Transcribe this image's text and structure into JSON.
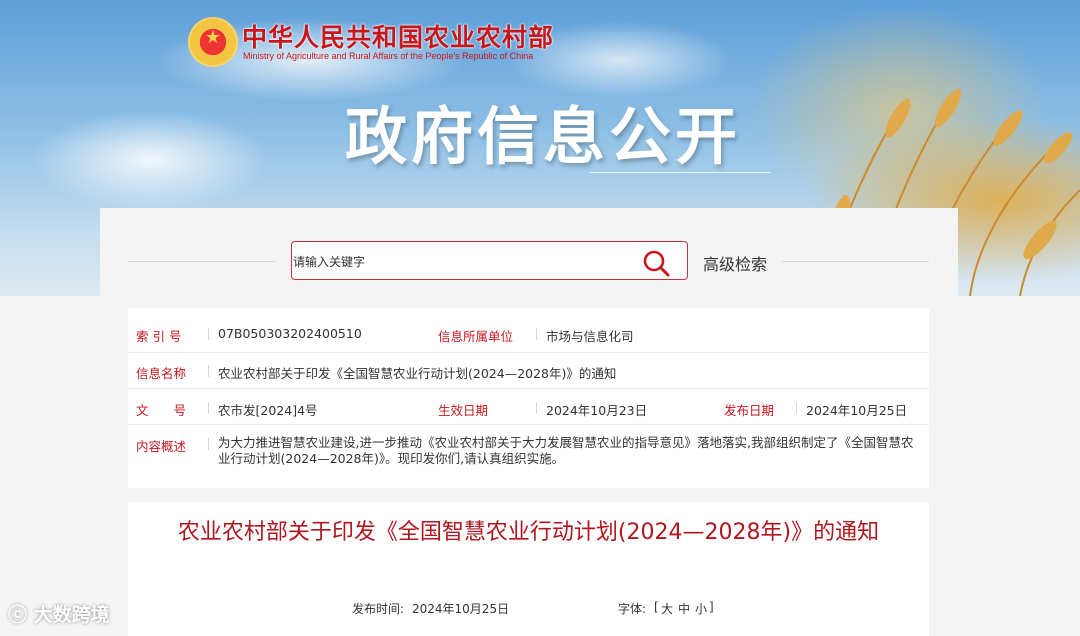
{
  "header": {
    "ministry_cn": "中华人民共和国农业农村部",
    "ministry_en": "Ministry of Agriculture and Rural Affairs of the People's Republic of China",
    "section_title": "政府信息公开"
  },
  "search": {
    "placeholder": "请输入关键字",
    "advanced_label": "高级检索",
    "icon": "search-icon"
  },
  "info": {
    "index_label": "索 引 号",
    "index_value": "07B050303202400510",
    "dept_label": "信息所属单位",
    "dept_value": "市场与信息化司",
    "name_label": "信息名称",
    "name_value": "农业农村部关于印发《全国智慧农业行动计划(2024—2028年)》的通知",
    "docno_label": "文　　号",
    "docno_value": "农市发[2024]4号",
    "effective_label": "生效日期",
    "effective_value": "2024年10月23日",
    "publish_label": "发布日期",
    "publish_value": "2024年10月25日",
    "summary_label": "内容概述",
    "summary_value": "为大力推进智慧农业建设,进一步推动《农业农村部关于大力发展智慧农业的指导意见》落地落实,我部组织制定了《全国智慧农业行动计划(2024—2028年)》。现印发你们,请认真组织实施。"
  },
  "doc": {
    "title": "农业农村部关于印发《全国智慧农业行动计划(2024—2028年)》的通知",
    "publish_time_label": "发布时间:",
    "publish_time_value": "2024年10月25日",
    "font_label": "字体:",
    "font_open": "[",
    "font_large": "大",
    "font_medium": "中",
    "font_small": "小",
    "font_close": "]"
  },
  "watermark": "大数跨境",
  "colors": {
    "accent": "#c8161d",
    "title_red": "#b0161d"
  }
}
